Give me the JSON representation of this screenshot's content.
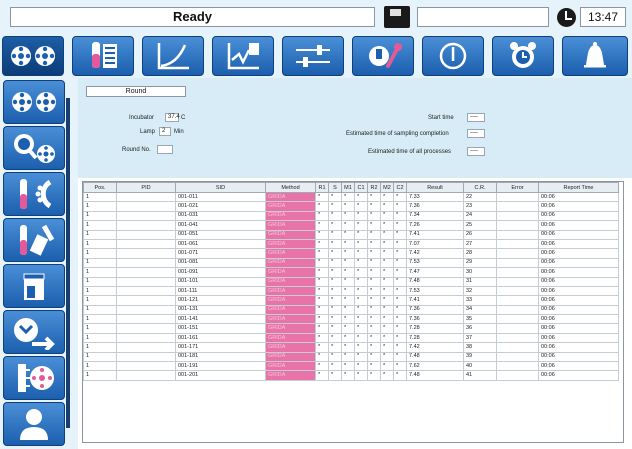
{
  "status_bar": {
    "status_text": "Ready",
    "message": "",
    "time": "13:47"
  },
  "toolbar": {
    "buttons": [
      {
        "name": "reagent-disc-icon",
        "active": true
      },
      {
        "name": "test-tubes-list-icon"
      },
      {
        "name": "calibration-curve-icon"
      },
      {
        "name": "qc-chart-icon"
      },
      {
        "name": "sliders-settings-icon"
      },
      {
        "name": "maintenance-wrench-icon"
      },
      {
        "name": "power-icon"
      },
      {
        "name": "alarm-clock-icon"
      },
      {
        "name": "bell-icon"
      }
    ]
  },
  "sidebar": {
    "buttons": [
      {
        "name": "reagent-disc-icon"
      },
      {
        "name": "search-sample-icon"
      },
      {
        "name": "sample-rack-icon"
      },
      {
        "name": "sample-tube-icon"
      },
      {
        "name": "cuvette-icon"
      },
      {
        "name": "run-arrow-icon"
      },
      {
        "name": "wash-disc-icon"
      },
      {
        "name": "user-icon"
      }
    ]
  },
  "round": {
    "label": "Round"
  },
  "info": {
    "incubator_label": "Incubator",
    "incubator_value": "37.4",
    "incubator_unit": "C",
    "lamp_label": "Lamp",
    "lamp_value": "2",
    "lamp_unit": "Min",
    "round_no_label": "Round No.",
    "round_no_value": "",
    "start_time_label": "Start time",
    "start_time_value": "----",
    "est_sampling_label": "Estimated time of sampling completion",
    "est_sampling_value": "----",
    "est_all_label": "Estimated time of all processes",
    "est_all_value": "----"
  },
  "table": {
    "columns": [
      "Pos.",
      "PID",
      "SID",
      "Method",
      "R1",
      "S",
      "M1",
      "C1",
      "R2",
      "M2",
      "C2",
      "Result",
      "C.R.",
      "Error",
      "Report Time"
    ],
    "rows": [
      [
        "1",
        "",
        "001-011",
        "GRIDA",
        "*",
        "*",
        "*",
        "*",
        "*",
        "*",
        "*",
        "7.33",
        "22",
        "",
        "00:06"
      ],
      [
        "1",
        "",
        "001-021",
        "GRIDA",
        "*",
        "*",
        "*",
        "*",
        "*",
        "*",
        "*",
        "7.36",
        "23",
        "",
        "00:06"
      ],
      [
        "1",
        "",
        "001-031",
        "GRIDA",
        "*",
        "*",
        "*",
        "*",
        "*",
        "*",
        "*",
        "7.34",
        "24",
        "",
        "00:06"
      ],
      [
        "1",
        "",
        "001-041",
        "GRIDA",
        "*",
        "*",
        "*",
        "*",
        "*",
        "*",
        "*",
        "7.26",
        "25",
        "",
        "00:06"
      ],
      [
        "1",
        "",
        "001-051",
        "GRIDA",
        "*",
        "*",
        "*",
        "*",
        "*",
        "*",
        "*",
        "7.41",
        "26",
        "",
        "00:06"
      ],
      [
        "1",
        "",
        "001-061",
        "GRIDA",
        "*",
        "*",
        "*",
        "*",
        "*",
        "*",
        "*",
        "7.07",
        "27",
        "",
        "00:06"
      ],
      [
        "1",
        "",
        "001-071",
        "GRIDA",
        "*",
        "*",
        "*",
        "*",
        "*",
        "*",
        "*",
        "7.42",
        "28",
        "",
        "00:06"
      ],
      [
        "1",
        "",
        "001-081",
        "GRIDA",
        "*",
        "*",
        "*",
        "*",
        "*",
        "*",
        "*",
        "7.53",
        "29",
        "",
        "00:06"
      ],
      [
        "1",
        "",
        "001-091",
        "GRIDA",
        "*",
        "*",
        "*",
        "*",
        "*",
        "*",
        "*",
        "7.47",
        "30",
        "",
        "00:06"
      ],
      [
        "1",
        "",
        "001-101",
        "GRIDA",
        "*",
        "*",
        "*",
        "*",
        "*",
        "*",
        "*",
        "7.48",
        "31",
        "",
        "00:06"
      ],
      [
        "1",
        "",
        "001-111",
        "GRIDA",
        "*",
        "*",
        "*",
        "*",
        "*",
        "*",
        "*",
        "7.53",
        "32",
        "",
        "00:06"
      ],
      [
        "1",
        "",
        "001-121",
        "GRIDA",
        "*",
        "*",
        "*",
        "*",
        "*",
        "*",
        "*",
        "7.41",
        "33",
        "",
        "00:06"
      ],
      [
        "1",
        "",
        "001-131",
        "GRIDA",
        "*",
        "*",
        "*",
        "*",
        "*",
        "*",
        "*",
        "7.36",
        "34",
        "",
        "00:06"
      ],
      [
        "1",
        "",
        "001-141",
        "GRIDA",
        "*",
        "*",
        "*",
        "*",
        "*",
        "*",
        "*",
        "7.36",
        "35",
        "",
        "00:06"
      ],
      [
        "1",
        "",
        "001-151",
        "GRIDA",
        "*",
        "*",
        "*",
        "*",
        "*",
        "*",
        "*",
        "7.28",
        "36",
        "",
        "00:06"
      ],
      [
        "1",
        "",
        "001-161",
        "GRIDA",
        "*",
        "*",
        "*",
        "*",
        "*",
        "*",
        "*",
        "7.28",
        "37",
        "",
        "00:06"
      ],
      [
        "1",
        "",
        "001-171",
        "GRIDA",
        "*",
        "*",
        "*",
        "*",
        "*",
        "*",
        "*",
        "7.42",
        "38",
        "",
        "00:06"
      ],
      [
        "1",
        "",
        "001-181",
        "GRIDA",
        "*",
        "*",
        "*",
        "*",
        "*",
        "*",
        "*",
        "7.48",
        "39",
        "",
        "00:06"
      ],
      [
        "1",
        "",
        "001-191",
        "GRIDA",
        "*",
        "*",
        "*",
        "*",
        "*",
        "*",
        "*",
        "7.62",
        "40",
        "",
        "00:06"
      ],
      [
        "1",
        "",
        "001-201",
        "GRIDA",
        "*",
        "*",
        "*",
        "*",
        "*",
        "*",
        "*",
        "7.48",
        "41",
        "",
        "00:06"
      ]
    ]
  },
  "colors": {
    "accent": "#1b5fae",
    "panel": "#d7ecf6",
    "method_cell": "#e873a8"
  }
}
